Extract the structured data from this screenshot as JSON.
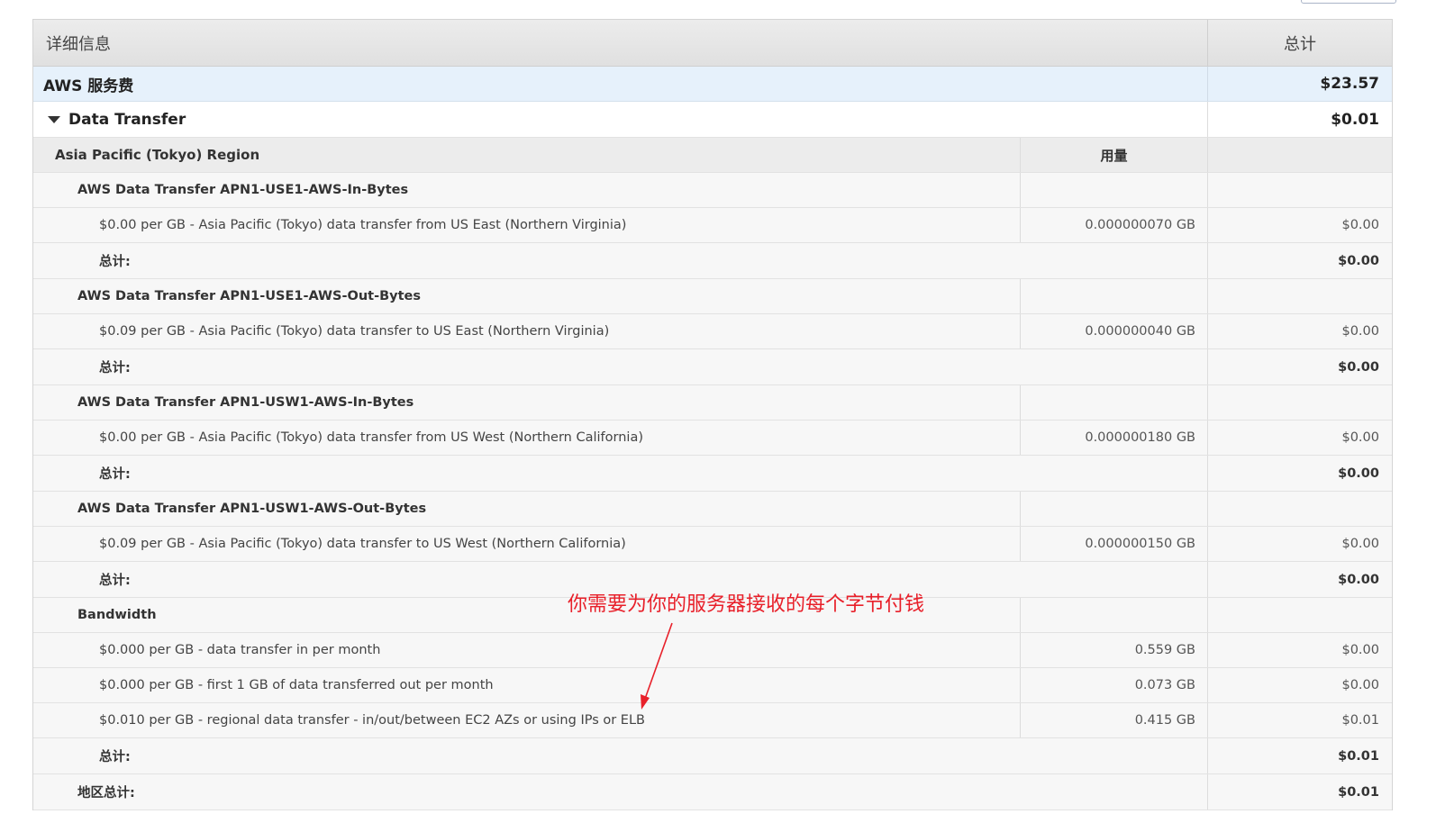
{
  "header": {
    "detail": "详细信息",
    "total": "总计"
  },
  "service": {
    "name": "AWS 服务费",
    "total": "$23.57"
  },
  "product": {
    "name": "Data Transfer",
    "total": "$0.01"
  },
  "region": {
    "name": "Asia Pacific (Tokyo) Region",
    "usage_header": "用量"
  },
  "groups": [
    {
      "name": "AWS Data Transfer APN1-USE1-AWS-In-Bytes",
      "items": [
        {
          "desc": "$0.00 per GB - Asia Pacific (Tokyo) data transfer from US East (Northern Virginia)",
          "usage": "0.000000070 GB",
          "cost": "$0.00"
        }
      ],
      "subtotal_label": "总计:",
      "subtotal": "$0.00"
    },
    {
      "name": "AWS Data Transfer APN1-USE1-AWS-Out-Bytes",
      "items": [
        {
          "desc": "$0.09 per GB - Asia Pacific (Tokyo) data transfer to US East (Northern Virginia)",
          "usage": "0.000000040 GB",
          "cost": "$0.00"
        }
      ],
      "subtotal_label": "总计:",
      "subtotal": "$0.00"
    },
    {
      "name": "AWS Data Transfer APN1-USW1-AWS-In-Bytes",
      "items": [
        {
          "desc": "$0.00 per GB - Asia Pacific (Tokyo) data transfer from US West (Northern California)",
          "usage": "0.000000180 GB",
          "cost": "$0.00"
        }
      ],
      "subtotal_label": "总计:",
      "subtotal": "$0.00"
    },
    {
      "name": "AWS Data Transfer APN1-USW1-AWS-Out-Bytes",
      "items": [
        {
          "desc": "$0.09 per GB - Asia Pacific (Tokyo) data transfer to US West (Northern California)",
          "usage": "0.000000150 GB",
          "cost": "$0.00"
        }
      ],
      "subtotal_label": "总计:",
      "subtotal": "$0.00"
    },
    {
      "name": "Bandwidth",
      "items": [
        {
          "desc": "$0.000 per GB - data transfer in per month",
          "usage": "0.559 GB",
          "cost": "$0.00"
        },
        {
          "desc": "$0.000 per GB - first 1 GB of data transferred out per month",
          "usage": "0.073 GB",
          "cost": "$0.00"
        },
        {
          "desc": "$0.010 per GB - regional data transfer - in/out/between EC2 AZs or using IPs or ELB",
          "usage": "0.415 GB",
          "cost": "$0.01"
        }
      ],
      "subtotal_label": "总计:",
      "subtotal": "$0.01"
    }
  ],
  "region_total": {
    "label": "地区总计:",
    "value": "$0.01"
  },
  "annotation": {
    "text": "你需要为你的服务器接收的每个字节付钱",
    "color": "#e8202a"
  }
}
